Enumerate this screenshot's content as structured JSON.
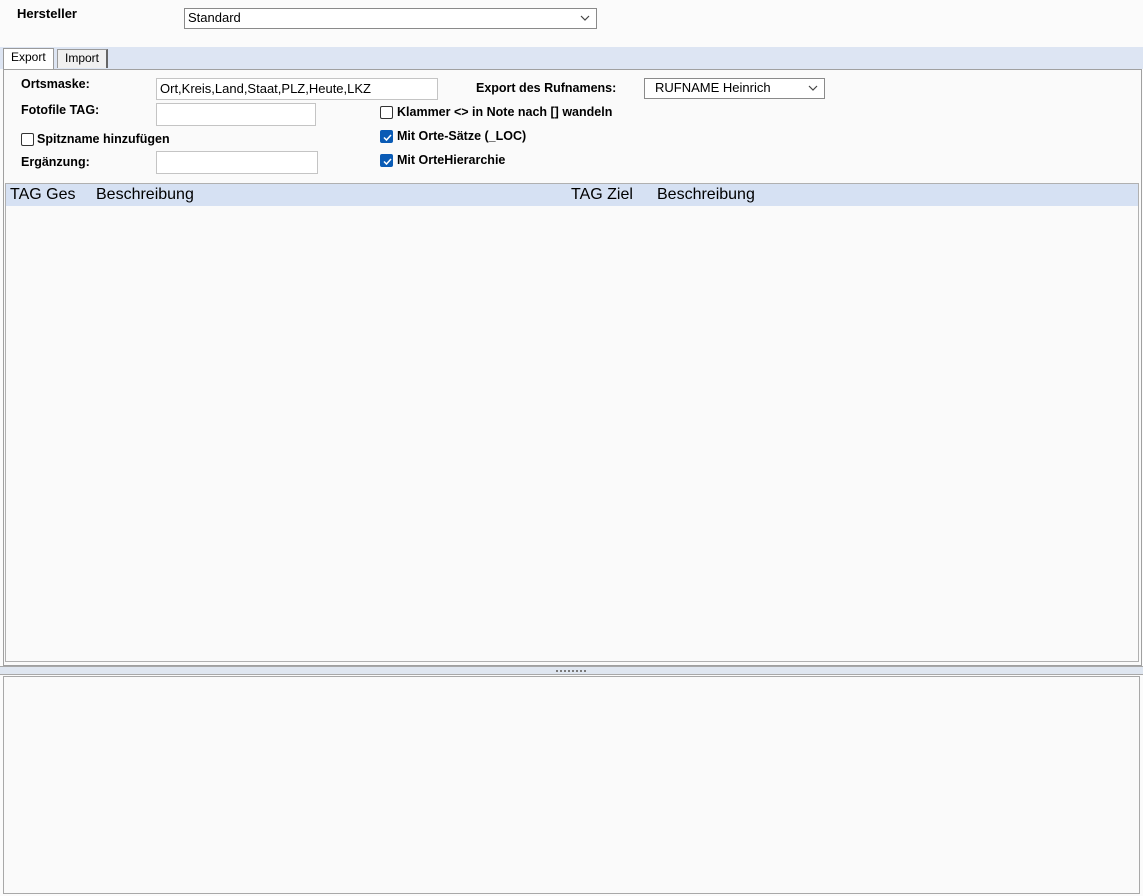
{
  "header": {
    "manufacturer_label": "Hersteller",
    "manufacturer_value": "Standard"
  },
  "tabs": [
    {
      "label": "Export",
      "active": true
    },
    {
      "label": "Import",
      "active": false
    }
  ],
  "export": {
    "ortsmaske_label": "Ortsmaske:",
    "ortsmaske_value": "Ort,Kreis,Land,Staat,PLZ,Heute,LKZ",
    "fotofile_label": "Fotofile TAG:",
    "fotofile_value": "",
    "spitzname_label": "Spitzname hinzufügen",
    "spitzname_checked": false,
    "ergaenzung_label": "Ergänzung:",
    "ergaenzung_value": "",
    "rufname_label": "Export des Rufnamens:",
    "rufname_value": "RUFNAME Heinrich",
    "klammer_label": "Klammer <> in Note nach [] wandeln",
    "klammer_checked": false,
    "orte_saetze_label": "Mit Orte-Sätze (_LOC)",
    "orte_saetze_checked": true,
    "orte_hierarchie_label": "Mit OrteHierarchie",
    "orte_hierarchie_checked": true
  },
  "grid": {
    "columns": [
      "TAG Ges",
      "Beschreibung",
      "TAG Ziel",
      "Beschreibung"
    ],
    "rows": []
  },
  "colors": {
    "accent": "#0a5bb5",
    "header_bg": "#d6e1f3",
    "tabstrip_bg": "#dde5f3"
  },
  "icons": {
    "dropdown": "chevron-down-icon",
    "checkmark": "checkmark-icon",
    "splitter": "grip-icon"
  }
}
